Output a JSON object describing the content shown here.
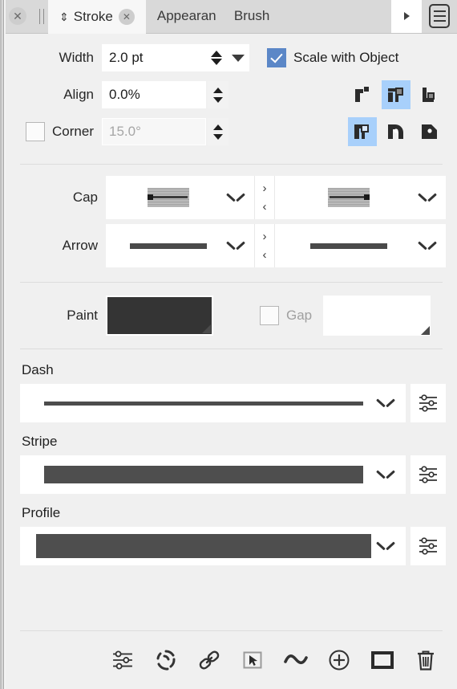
{
  "window": {
    "title": "Stroke"
  },
  "tabbar": {
    "close_icon": "close-icon",
    "grip_icon": "drag-grip-icon",
    "tabs": [
      {
        "label": "Stroke",
        "active": true,
        "sort_glyph": "⇕",
        "close_glyph": "✕"
      },
      {
        "label": "Appearan",
        "active": false
      },
      {
        "label": "Brush",
        "active": false
      }
    ],
    "overflow_icon": "overflow-arrow-icon",
    "menu_icon": "panel-menu-icon"
  },
  "stroke": {
    "width": {
      "label": "Width",
      "value": "2.0 pt"
    },
    "align": {
      "label": "Align",
      "value": "0.0%"
    },
    "corner": {
      "label": "Corner",
      "value": "15.0°",
      "checked": false
    },
    "scale_with_object": {
      "label": "Scale with Object",
      "checked": true
    },
    "align_buttons": [
      {
        "name": "align-inside-icon",
        "selected": false
      },
      {
        "name": "align-center-icon",
        "selected": true
      },
      {
        "name": "align-outside-icon",
        "selected": false
      }
    ],
    "join_buttons": [
      {
        "name": "join-miter-icon",
        "selected": true
      },
      {
        "name": "join-round-icon",
        "selected": false
      },
      {
        "name": "join-bevel-icon",
        "selected": false
      }
    ]
  },
  "cap": {
    "label": "Cap",
    "start_preview": "cap-butt-start-preview",
    "end_preview": "cap-butt-end-preview",
    "next_glyph": "›",
    "prev_glyph": "‹"
  },
  "arrow": {
    "label": "Arrow",
    "start_preview": "arrow-none-start-preview",
    "end_preview": "arrow-none-end-preview",
    "next_glyph": "›",
    "prev_glyph": "‹"
  },
  "paint": {
    "label": "Paint",
    "color": "#343434",
    "gap": {
      "label": "Gap",
      "checked": false,
      "color": "#ffffff"
    }
  },
  "dash": {
    "title": "Dash",
    "preview": "solid-line-preview",
    "options_icon": "sliders-icon"
  },
  "stripe": {
    "title": "Stripe",
    "preview": "solid-bar-preview",
    "options_icon": "sliders-icon"
  },
  "profile": {
    "title": "Profile",
    "preview": "uniform-profile-preview",
    "options_icon": "sliders-icon"
  },
  "footer": {
    "buttons": [
      {
        "name": "sliders-icon"
      },
      {
        "name": "pressure-icon"
      },
      {
        "name": "link-icon"
      },
      {
        "name": "select-pointer-icon"
      },
      {
        "name": "wave-icon"
      },
      {
        "name": "add-circle-icon"
      },
      {
        "name": "rectangle-icon"
      },
      {
        "name": "trash-icon"
      }
    ]
  },
  "colors": {
    "accent": "#5b87c7",
    "selected_button": "#a8d0fb",
    "panel_bg": "#f0f0f0",
    "field_bg": "#ffffff",
    "tabbar_bg": "#d9d9d9",
    "text": "#1f1f1f",
    "stroke_dark": "#4c4c4c"
  }
}
